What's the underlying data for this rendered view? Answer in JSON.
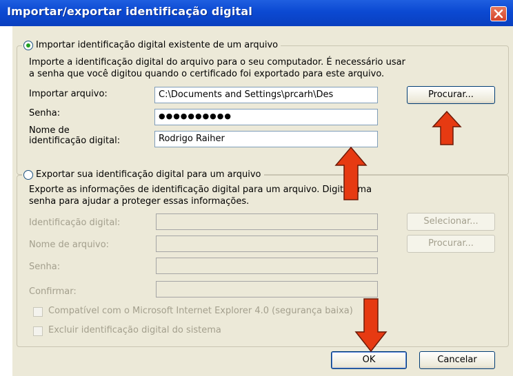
{
  "window": {
    "title": "Importar/exportar identificação digital"
  },
  "import_section": {
    "radio_label": "Importar identificação digital existente de um arquivo",
    "description": "Importe a identificação digital do arquivo para o seu computador. É necessário usar\na senha que você digitou quando o certificado foi exportado para este arquivo.",
    "file_label": "Importar arquivo:",
    "file_value": "C:\\Documents and Settings\\prcarh\\Des",
    "browse_label": "Procurar...",
    "password_label": "Senha:",
    "password_value": "●●●●●●●●●●",
    "name_label": "Nome de\nidentificação digital:",
    "name_value": "Rodrigo Raiher",
    "selected": true
  },
  "export_section": {
    "radio_label": "Exportar sua identificação digital para um arquivo",
    "description": "Exporte as informações de identificação digital para um arquivo. Digite uma\nsenha para ajudar a proteger essas informações.",
    "id_label": "Identificação digital:",
    "select_label": "Selecionar...",
    "file_label": "Nome de arquivo:",
    "browse_label": "Procurar...",
    "password_label": "Senha:",
    "confirm_label": "Confirmar:",
    "ie_compat_label": "Compatível com o Microsoft Internet Explorer 4.0 (segurança baixa)",
    "delete_label": "Excluir identificação digital do sistema",
    "selected": false
  },
  "footer": {
    "ok_label": "OK",
    "cancel_label": "Cancelar"
  },
  "colors": {
    "annotation_arrow": "#e63a12",
    "titlebar": "#0b49d2"
  }
}
